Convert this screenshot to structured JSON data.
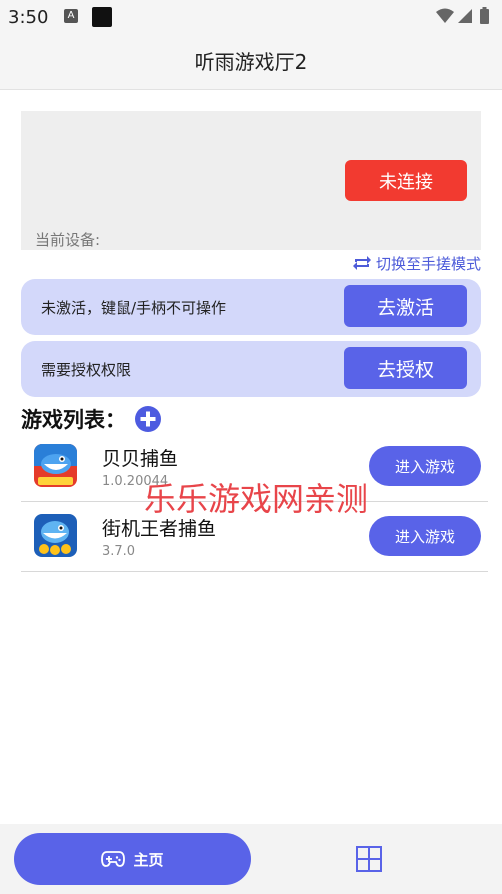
{
  "status_bar": {
    "time": "3:50",
    "a_icon": "A"
  },
  "header": {
    "title": "听雨游戏厅2"
  },
  "device": {
    "connect_button": "未连接",
    "current_device_label": "当前设备:"
  },
  "switch_mode": {
    "label": "切换至手搓模式",
    "icon": "swap-icon"
  },
  "activation": {
    "text": "未激活，键鼠/手柄不可操作",
    "button": "去激活"
  },
  "authorization": {
    "text": "需要授权权限",
    "button": "去授权"
  },
  "games": {
    "title": "游戏列表：",
    "items": [
      {
        "name": "贝贝捕鱼",
        "version": "1.0.20044",
        "button": "进入游戏"
      },
      {
        "name": "街机王者捕鱼",
        "version": "3.7.0",
        "button": "进入游戏"
      }
    ]
  },
  "watermark": "乐乐游戏网亲测",
  "bottom_nav": {
    "home_label": "主页",
    "home_icon": "gamepad-icon",
    "grid_icon": "grid-icon"
  },
  "colors": {
    "accent": "#5963e8",
    "danger": "#f23a30",
    "card_bg": "#d3d8fa"
  }
}
